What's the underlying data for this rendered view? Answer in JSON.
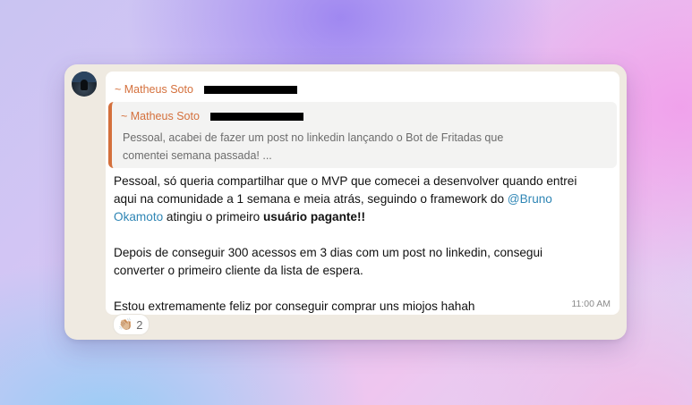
{
  "message": {
    "sender": "~ Matheus Soto",
    "quote": {
      "sender": "~ Matheus Soto",
      "text_line1": "Pessoal, acabei de fazer um post no linkedin lançando o Bot de Fritadas que",
      "text_line2": "comentei semana passada! ..."
    },
    "body": {
      "p1_line1": "Pessoal, só queria compartilhar que o MVP que comecei a desenvolver quando entrei",
      "p1_line2_a": "aqui na comunidade a 1 semana e meia atrás, seguindo o framework do ",
      "mention_part1": "@Bruno",
      "mention_part2": "Okamoto",
      "p1_line3_b": " atingiu o primeiro ",
      "p1_bold": "usuário pagante!!",
      "p2_line1": "Depois de conseguir 300 acessos em 3 dias com um post no linkedin, consegui",
      "p2_line2": "converter o primeiro cliente da lista de espera.",
      "p3_line1": "Estou extremamente feliz por conseguir comprar uns miojos hahah"
    },
    "time": "11:00 AM",
    "reaction": {
      "emoji": "👏🏼",
      "count": "2"
    }
  },
  "colors": {
    "sender": "#d4703c",
    "mention": "#2f86b5",
    "bubble": "#ffffff",
    "chat_bg": "#efeae1"
  }
}
